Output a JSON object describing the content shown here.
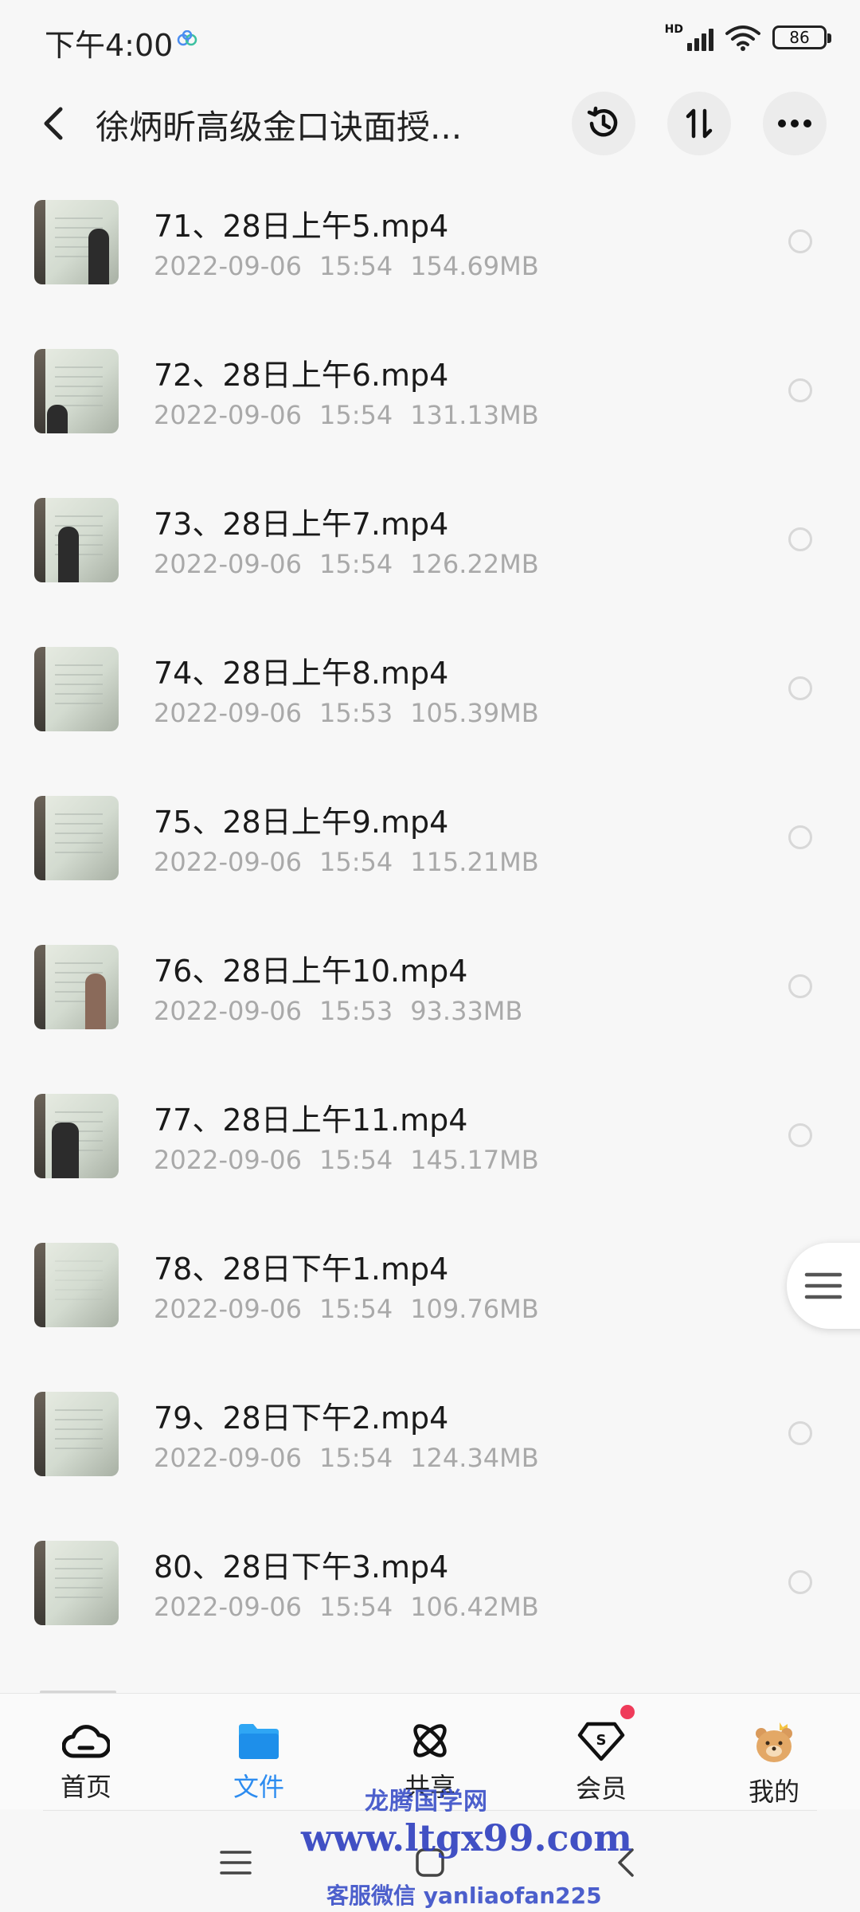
{
  "status_bar": {
    "time": "下午4:00",
    "hd": "HD",
    "battery": "86"
  },
  "header": {
    "title": "徐炳昕高级金口诀面授..."
  },
  "files": [
    {
      "name": "71、28日上午5.mp4",
      "date": "2022-09-06",
      "time": "15:54",
      "size": "154.69MB"
    },
    {
      "name": "72、28日上午6.mp4",
      "date": "2022-09-06",
      "time": "15:54",
      "size": "131.13MB"
    },
    {
      "name": "73、28日上午7.mp4",
      "date": "2022-09-06",
      "time": "15:54",
      "size": "126.22MB"
    },
    {
      "name": "74、28日上午8.mp4",
      "date": "2022-09-06",
      "time": "15:53",
      "size": "105.39MB"
    },
    {
      "name": "75、28日上午9.mp4",
      "date": "2022-09-06",
      "time": "15:54",
      "size": "115.21MB"
    },
    {
      "name": "76、28日上午10.mp4",
      "date": "2022-09-06",
      "time": "15:53",
      "size": "93.33MB"
    },
    {
      "name": "77、28日上午11.mp4",
      "date": "2022-09-06",
      "time": "15:54",
      "size": "145.17MB"
    },
    {
      "name": "78、28日下午1.mp4",
      "date": "2022-09-06",
      "time": "15:54",
      "size": "109.76MB"
    },
    {
      "name": "79、28日下午2.mp4",
      "date": "2022-09-06",
      "time": "15:54",
      "size": "124.34MB"
    },
    {
      "name": "80、28日下午3.mp4",
      "date": "2022-09-06",
      "time": "15:54",
      "size": "106.42MB"
    }
  ],
  "bottom_nav": {
    "tabs": [
      {
        "label": "首页",
        "icon": "cloud-home-icon"
      },
      {
        "label": "文件",
        "icon": "folder-icon"
      },
      {
        "label": "共享",
        "icon": "share-atom-icon"
      },
      {
        "label": "会员",
        "icon": "vip-icon"
      },
      {
        "label": "我的",
        "icon": "bear-avatar-icon"
      }
    ]
  },
  "watermark": {
    "line1": "龙腾国学网",
    "line2": "www.ltgx99.com",
    "line3": "客服微信 yanliaofan225"
  },
  "colors": {
    "accent": "#2d8cf0",
    "badge": "#ef3b5a",
    "watermark": "#2e3fbf"
  }
}
